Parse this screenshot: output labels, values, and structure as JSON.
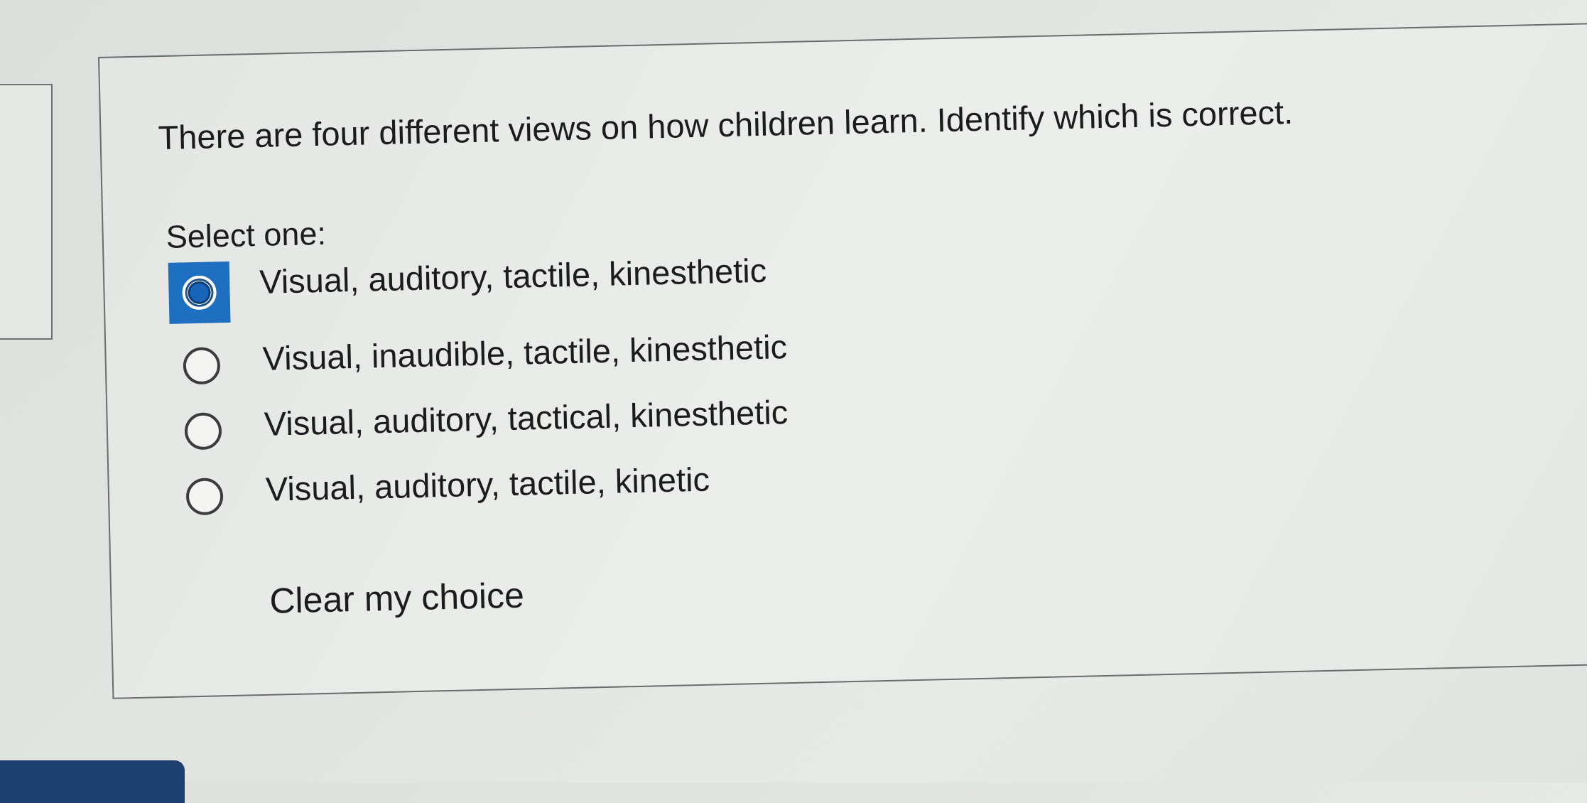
{
  "question": {
    "text": "There are four different views on how children learn. Identify which is correct.",
    "prompt": "Select one:"
  },
  "options": [
    {
      "label": "Visual, auditory, tactile, kinesthetic",
      "selected": true
    },
    {
      "label": "Visual, inaudible, tactile, kinesthetic",
      "selected": false
    },
    {
      "label": "Visual, auditory, tactical, kinesthetic",
      "selected": false
    },
    {
      "label": "Visual, auditory, tactile, kinetic",
      "selected": false
    }
  ],
  "clear_label": "Clear my choice",
  "colors": {
    "selected_accent": "#1e6fc0",
    "bottom_bar": "#1d3f6e"
  }
}
